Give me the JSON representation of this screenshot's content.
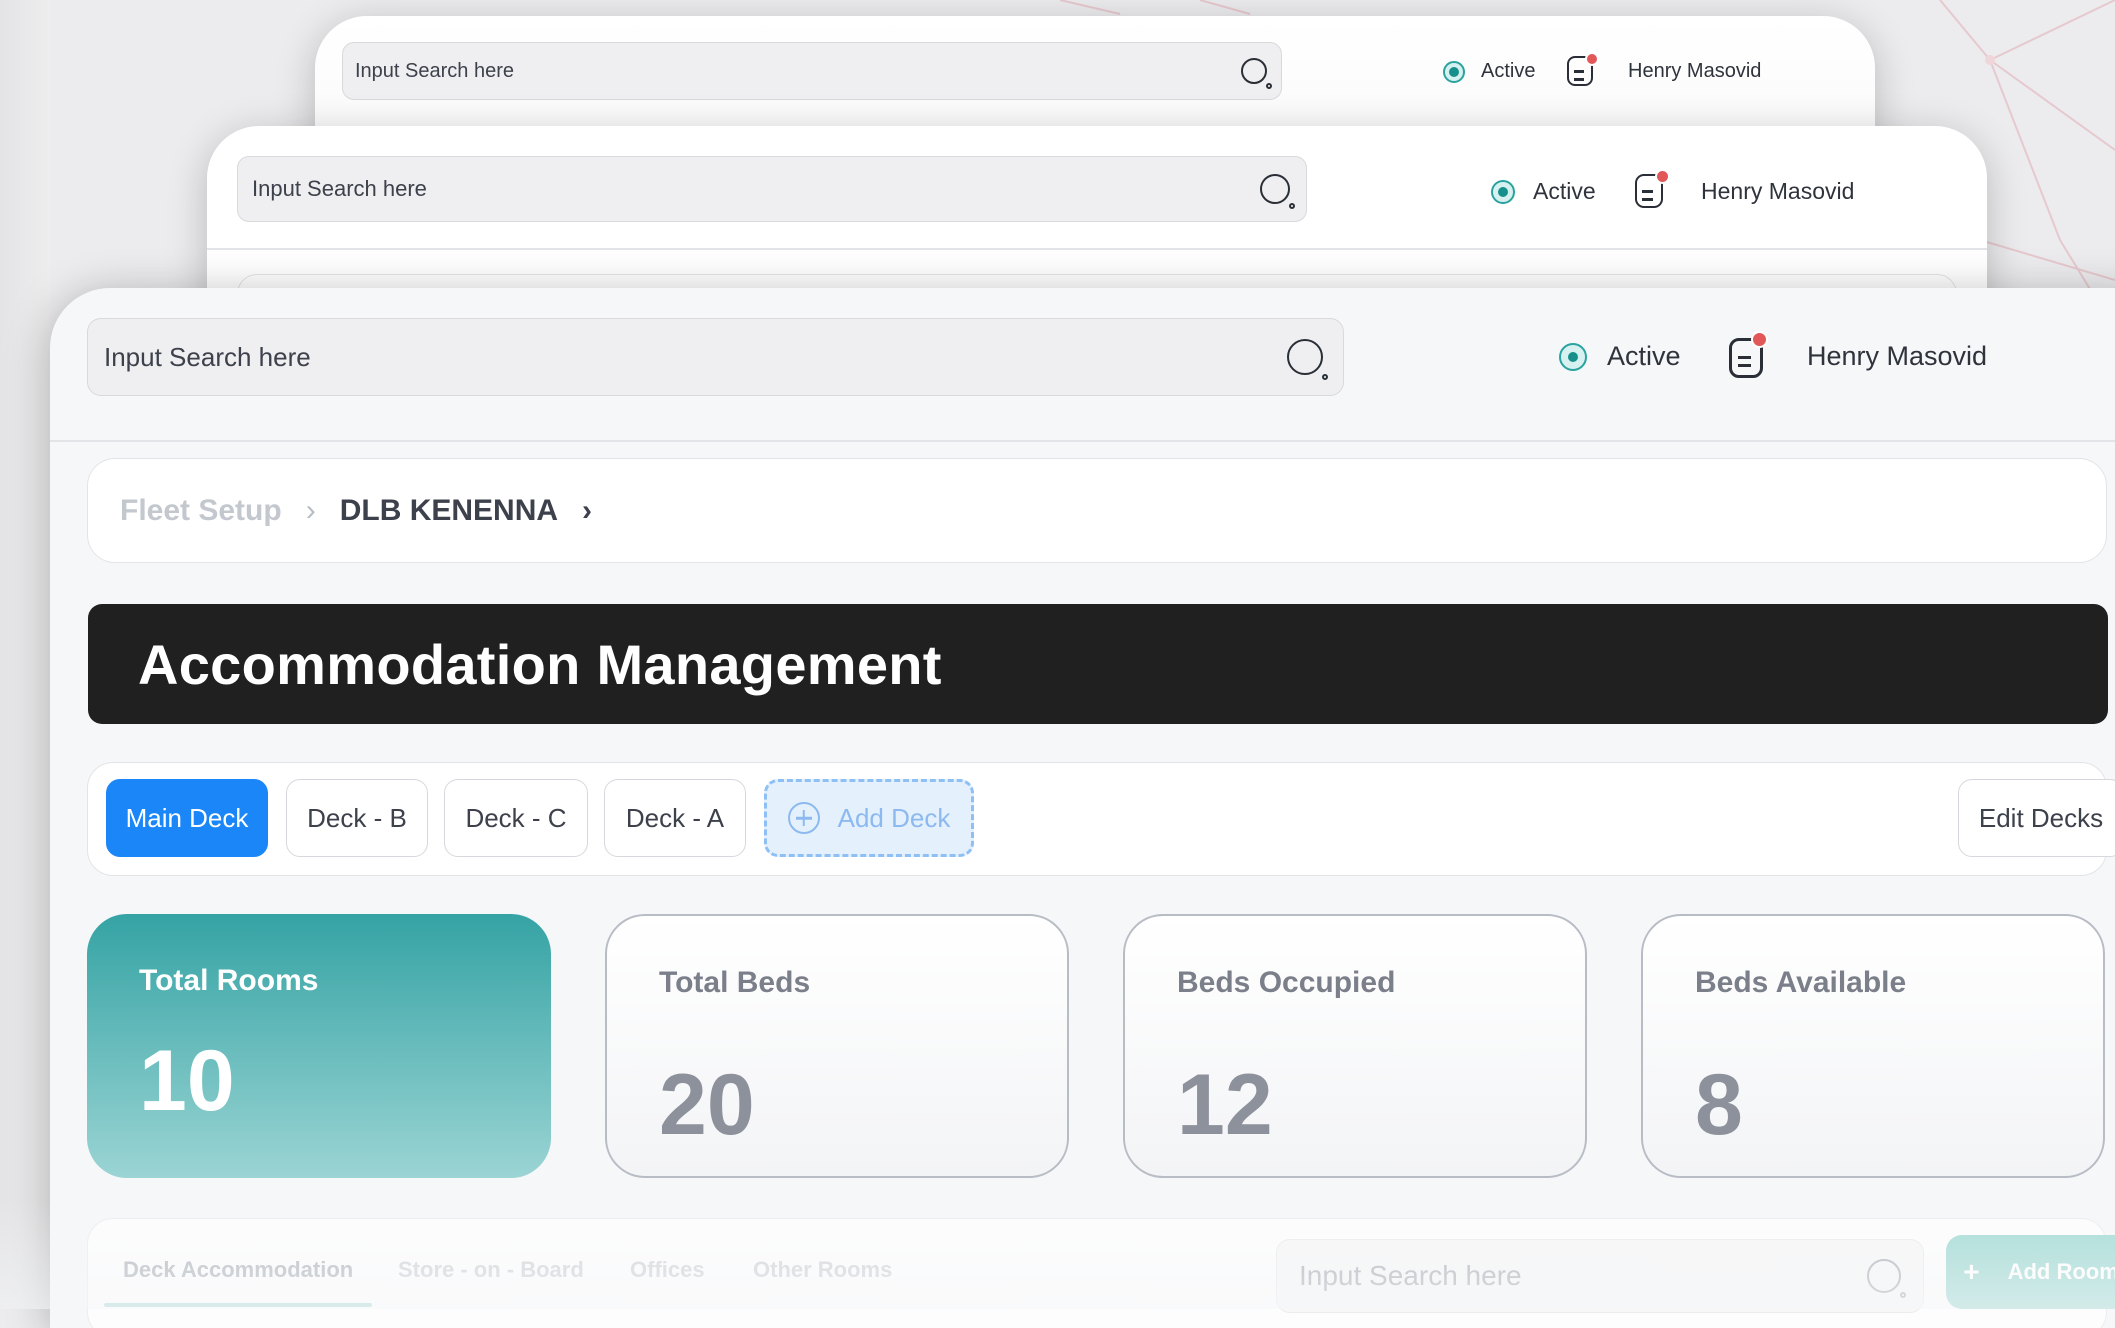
{
  "windows": [
    {
      "search_placeholder": "Input Search here",
      "status": "Active",
      "user_name": "Henry Masovid"
    },
    {
      "search_placeholder": "Input Search here",
      "status": "Active",
      "user_name": "Henry Masovid"
    },
    {
      "search_placeholder": "Input Search here",
      "status": "Active",
      "user_name": "Henry Masovid"
    }
  ],
  "breadcrumb": {
    "parent": "Fleet Setup",
    "current": "DLB KENENNA"
  },
  "page_title": "Accommodation Management",
  "decks": {
    "tabs": [
      {
        "label": "Main Deck",
        "active": true
      },
      {
        "label": "Deck - B",
        "active": false
      },
      {
        "label": "Deck - C",
        "active": false
      },
      {
        "label": "Deck - A",
        "active": false
      }
    ],
    "add_label": "Add Deck",
    "edit_label": "Edit Decks"
  },
  "stats": [
    {
      "label": "Total Rooms",
      "value": "10"
    },
    {
      "label": "Total Beds",
      "value": "20"
    },
    {
      "label": "Beds Occupied",
      "value": "12"
    },
    {
      "label": "Beds Available",
      "value": "8"
    }
  ],
  "rooms": {
    "tabs": [
      "Deck Accommodation",
      "Store - on - Board",
      "Offices",
      "Other Rooms"
    ],
    "search_placeholder": "Input Search here",
    "add_label": "Add Room"
  },
  "colors": {
    "accent_blue": "#1a86f8",
    "teal": "#35a3a4",
    "hero_bg": "#202020",
    "notification": "#e25757"
  }
}
